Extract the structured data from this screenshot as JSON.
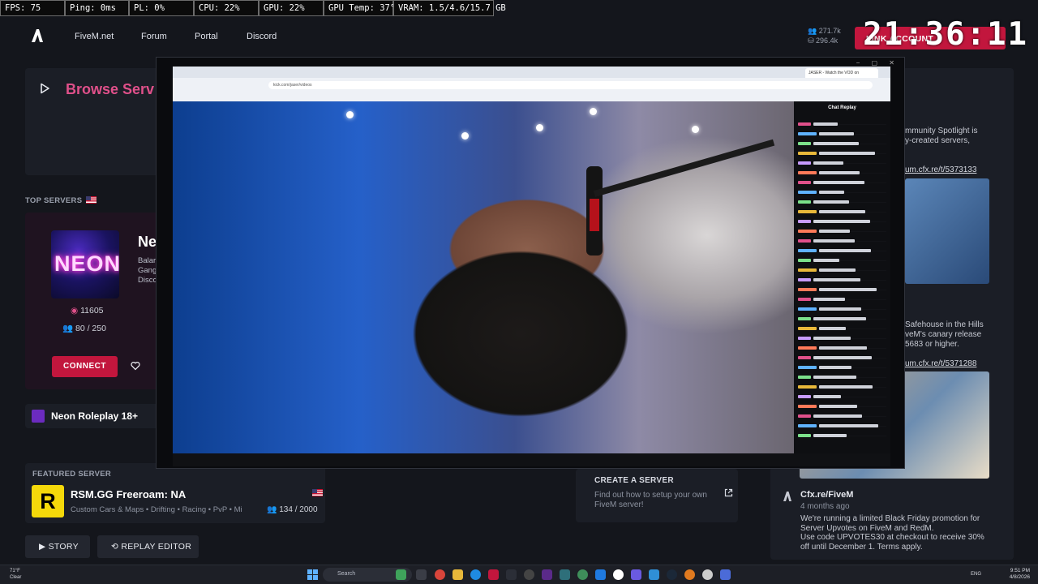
{
  "overlay_stats": [
    "FPS: 75",
    "Ping: 0ms",
    "PL: 0%",
    "CPU: 22%",
    "GPU: 22%",
    "GPU Temp: 37°C",
    "VRAM: 1.5/4.6/15.7 GB"
  ],
  "clock": "21:36:11",
  "nav": {
    "items": [
      "FiveM.net",
      "Forum",
      "Portal",
      "Discord"
    ],
    "count_top": "271.7k",
    "count_bottom": "296.4k",
    "link_account": "LINK ACCOUNT"
  },
  "browse": {
    "title": "Browse Serv"
  },
  "top_servers": {
    "label": "TOP SERVERS"
  },
  "server_card": {
    "title": "Ne",
    "desc": [
      "Balar",
      "Gang",
      "Disco"
    ],
    "image_text": "NEON",
    "votes": "11605",
    "players": "80 / 250",
    "connect": "CONNECT"
  },
  "neon_row": {
    "label": "Neon Roleplay 18+"
  },
  "featured": {
    "label": "FEATURED SERVER",
    "name": "RSM.GG Freeroam: NA",
    "logo": "R",
    "tags": "Custom Cars & Maps • Drifting • Racing • PvP • Mi",
    "players": "134 / 2000"
  },
  "buttons": {
    "story": "STORY",
    "replay_editor": "REPLAY EDITOR"
  },
  "create_server": {
    "title": "CREATE A SERVER",
    "desc": "Find out how to setup your own FiveM server!"
  },
  "news": {
    "p1": [
      "mmunity Spotlight is",
      "y-created servers,"
    ],
    "link1": "um.cfx.re/t/5373133",
    "p2": [
      "Safehouse in the Hills",
      "veM's canary release",
      "5683 or higher."
    ],
    "link2": "um.cfx.re/t/5371288",
    "author": "Cfx.re/FiveM",
    "ago": "4 months ago",
    "body": "We're running a limited Black Friday promotion for Server Upvotes on FiveM and RedM.\nUse code UPVOTES30 at checkout to receive 30% off until December 1. Terms apply."
  },
  "video": {
    "window_controls": "− ▢ ✕",
    "tab_title": "JASER - Watch the VOD on",
    "url": "kick.com/jaser/videos",
    "chat_title": "Chat Replay"
  },
  "taskbar": {
    "weather_temp": "71°F",
    "weather_desc": "Clear",
    "search": "Search",
    "lang": "ENG",
    "time": "9:51 PM",
    "date": "4/8/2026"
  },
  "colors": {
    "accent": "#c2163d",
    "browse_title": "#e0508a",
    "bg": "#14161c",
    "panel": "#1b1e26"
  }
}
